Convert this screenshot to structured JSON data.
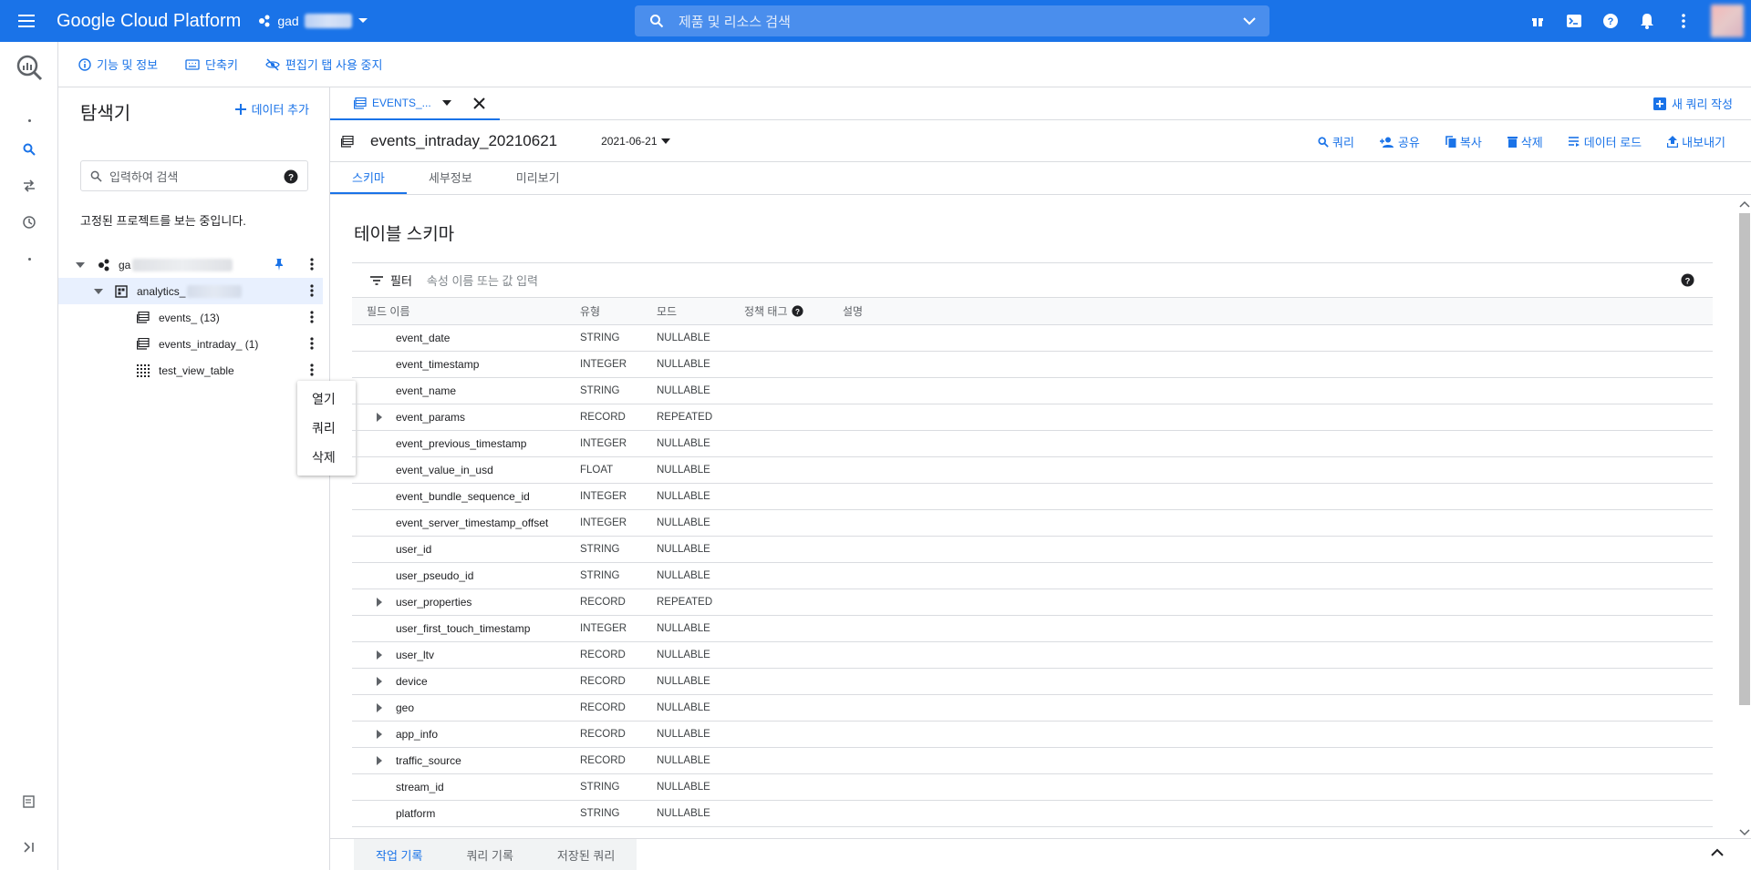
{
  "topbar": {
    "brand": "Google Cloud Platform",
    "project_prefix": "gad",
    "search_placeholder": "제품 및 리소스 검색",
    "icons": [
      "gift-icon",
      "cloud-shell-icon",
      "help-icon",
      "notifications-icon",
      "more-vert-icon"
    ]
  },
  "subbar": {
    "features": "기능 및 정보",
    "shortcuts": "단축키",
    "disable_tabs": "편집기 탭 사용 중지"
  },
  "explorer": {
    "title": "탐색기",
    "add_data": "데이터 추가",
    "search_placeholder": "입력하여 검색",
    "pinned_note": "고정된 프로젝트를 보는 중입니다.",
    "project_prefix": "ga",
    "dataset_prefix": "analytics_",
    "tables": [
      {
        "label": "events_ (13)",
        "icon": "table-icon"
      },
      {
        "label": "events_intraday_ (1)",
        "icon": "table-icon"
      },
      {
        "label": "test_view_table",
        "icon": "view-icon"
      }
    ],
    "context_menu": [
      "열기",
      "쿼리",
      "삭제"
    ]
  },
  "main": {
    "tab_label": "EVENTS_...",
    "new_query": "새 쿼리 작성",
    "table_name": "events_intraday_20210621",
    "date": "2021-06-21",
    "actions": [
      "쿼리",
      "공유",
      "복사",
      "삭제",
      "데이터 로드",
      "내보내기"
    ],
    "subtabs": [
      "스키마",
      "세부정보",
      "미리보기"
    ],
    "schema_title": "테이블 스키마",
    "filter_label": "필터",
    "filter_placeholder": "속성 이름 또는 값 입력",
    "columns": {
      "name": "필드 이름",
      "type": "유형",
      "mode": "모드",
      "tag": "정책 태그",
      "desc": "설명"
    },
    "rows": [
      {
        "name": "event_date",
        "type": "STRING",
        "mode": "NULLABLE",
        "expandable": false
      },
      {
        "name": "event_timestamp",
        "type": "INTEGER",
        "mode": "NULLABLE",
        "expandable": false
      },
      {
        "name": "event_name",
        "type": "STRING",
        "mode": "NULLABLE",
        "expandable": false
      },
      {
        "name": "event_params",
        "type": "RECORD",
        "mode": "REPEATED",
        "expandable": true
      },
      {
        "name": "event_previous_timestamp",
        "type": "INTEGER",
        "mode": "NULLABLE",
        "expandable": false
      },
      {
        "name": "event_value_in_usd",
        "type": "FLOAT",
        "mode": "NULLABLE",
        "expandable": false
      },
      {
        "name": "event_bundle_sequence_id",
        "type": "INTEGER",
        "mode": "NULLABLE",
        "expandable": false
      },
      {
        "name": "event_server_timestamp_offset",
        "type": "INTEGER",
        "mode": "NULLABLE",
        "expandable": false
      },
      {
        "name": "user_id",
        "type": "STRING",
        "mode": "NULLABLE",
        "expandable": false
      },
      {
        "name": "user_pseudo_id",
        "type": "STRING",
        "mode": "NULLABLE",
        "expandable": false
      },
      {
        "name": "user_properties",
        "type": "RECORD",
        "mode": "REPEATED",
        "expandable": true
      },
      {
        "name": "user_first_touch_timestamp",
        "type": "INTEGER",
        "mode": "NULLABLE",
        "expandable": false
      },
      {
        "name": "user_ltv",
        "type": "RECORD",
        "mode": "NULLABLE",
        "expandable": true
      },
      {
        "name": "device",
        "type": "RECORD",
        "mode": "NULLABLE",
        "expandable": true
      },
      {
        "name": "geo",
        "type": "RECORD",
        "mode": "NULLABLE",
        "expandable": true
      },
      {
        "name": "app_info",
        "type": "RECORD",
        "mode": "NULLABLE",
        "expandable": true
      },
      {
        "name": "traffic_source",
        "type": "RECORD",
        "mode": "NULLABLE",
        "expandable": true
      },
      {
        "name": "stream_id",
        "type": "STRING",
        "mode": "NULLABLE",
        "expandable": false
      },
      {
        "name": "platform",
        "type": "STRING",
        "mode": "NULLABLE",
        "expandable": false
      }
    ],
    "bottom_tabs": [
      "작업 기록",
      "쿼리 기록",
      "저장된 쿼리"
    ]
  },
  "colors": {
    "accent": "#1a73e8",
    "topbar": "#1a73e8",
    "border": "#dadce0"
  }
}
